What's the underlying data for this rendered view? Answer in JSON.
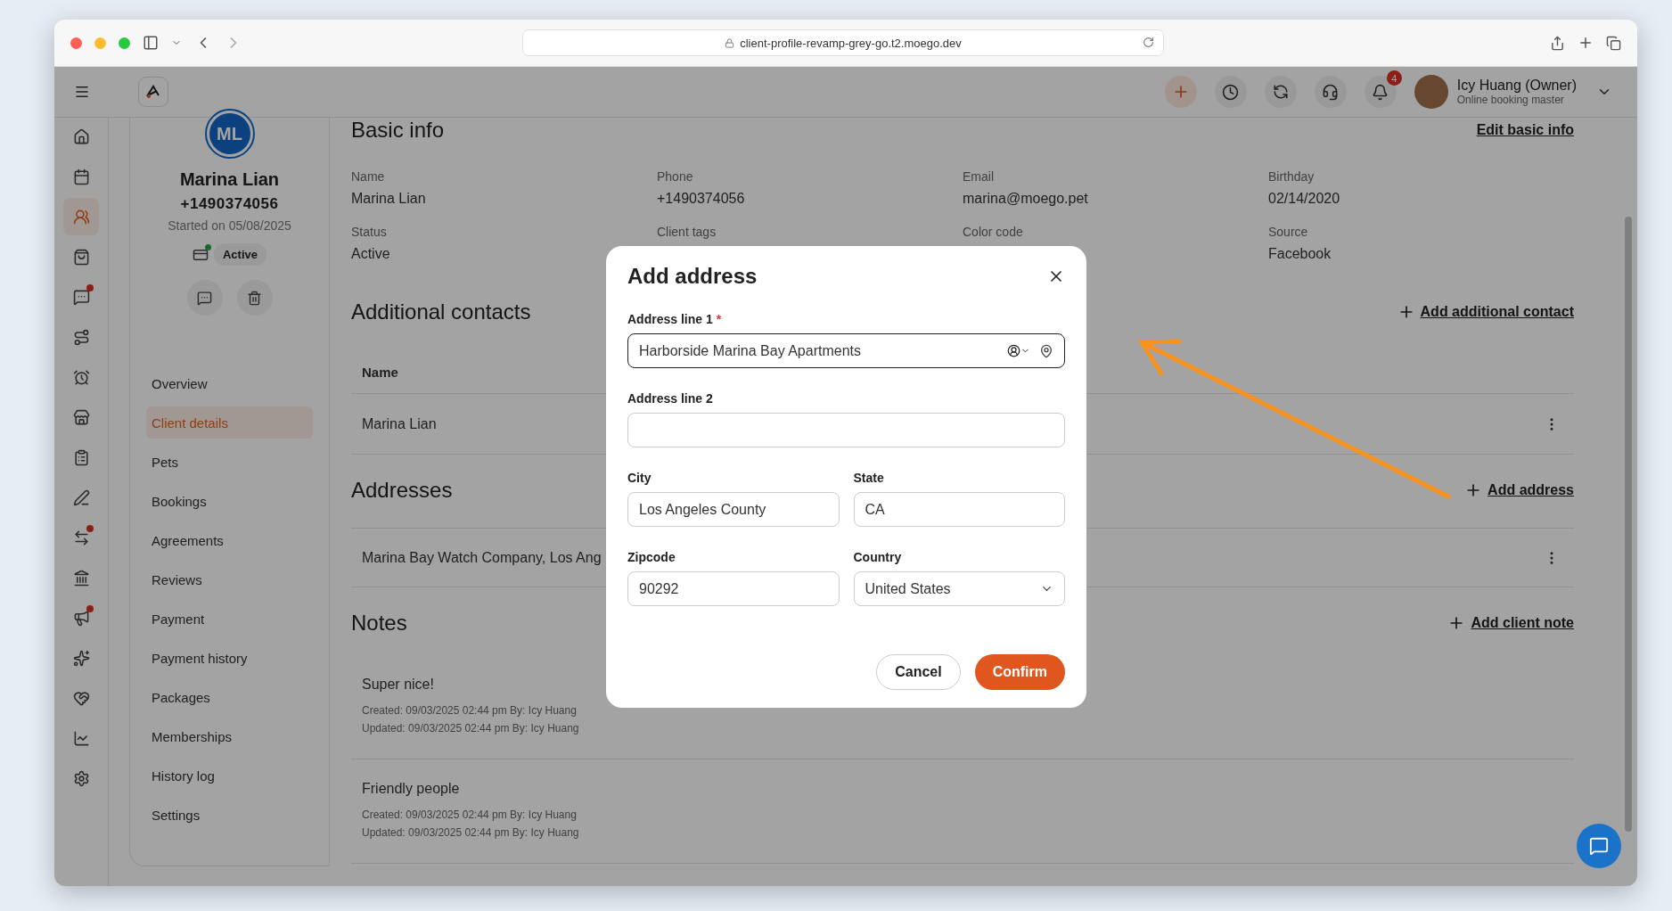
{
  "browser": {
    "url": "client-profile-revamp-grey-go.t2.moego.dev"
  },
  "app_bar": {
    "user_name": "Icy Huang (Owner)",
    "user_role": "Online booking master",
    "notification_count": "4"
  },
  "rail": {
    "items": [
      {
        "kind": "home",
        "selected": false,
        "dot": false
      },
      {
        "kind": "calendar",
        "selected": false,
        "dot": false
      },
      {
        "kind": "clients",
        "selected": true,
        "dot": false
      },
      {
        "kind": "bag",
        "selected": false,
        "dot": false
      },
      {
        "kind": "chat",
        "selected": false,
        "dot": true
      },
      {
        "kind": "route",
        "selected": false,
        "dot": false
      },
      {
        "kind": "alarm",
        "selected": false,
        "dot": false
      },
      {
        "kind": "store",
        "selected": false,
        "dot": false
      },
      {
        "kind": "clipboard",
        "selected": false,
        "dot": false
      },
      {
        "kind": "pen",
        "selected": false,
        "dot": false
      },
      {
        "kind": "swap",
        "selected": false,
        "dot": true
      },
      {
        "kind": "bank",
        "selected": false,
        "dot": false
      },
      {
        "kind": "megaphone",
        "selected": false,
        "dot": true
      },
      {
        "kind": "stars",
        "selected": false,
        "dot": false
      },
      {
        "kind": "heart",
        "selected": false,
        "dot": false
      },
      {
        "kind": "chart",
        "selected": false,
        "dot": false
      },
      {
        "kind": "settings",
        "selected": false,
        "dot": false
      }
    ]
  },
  "profile": {
    "initials": "ML",
    "name": "Marina Lian",
    "phone": "+1490374056",
    "started": "Started on 05/08/2025",
    "status": "Active",
    "nav": [
      {
        "label": "Overview",
        "selected": false
      },
      {
        "label": "Client details",
        "selected": true
      },
      {
        "label": "Pets",
        "selected": false
      },
      {
        "label": "Bookings",
        "selected": false
      },
      {
        "label": "Agreements",
        "selected": false
      },
      {
        "label": "Reviews",
        "selected": false
      },
      {
        "label": "Payment",
        "selected": false
      },
      {
        "label": "Payment history",
        "selected": false
      },
      {
        "label": "Packages",
        "selected": false
      },
      {
        "label": "Memberships",
        "selected": false
      },
      {
        "label": "History log",
        "selected": false
      },
      {
        "label": "Settings",
        "selected": false
      }
    ]
  },
  "basic_info": {
    "title": "Basic info",
    "action": "Edit basic info",
    "fields": [
      {
        "label": "Name",
        "value": "Marina Lian"
      },
      {
        "label": "Phone",
        "value": "+1490374056"
      },
      {
        "label": "Email",
        "value": "marina@moego.pet"
      },
      {
        "label": "Birthday",
        "value": "02/14/2020"
      },
      {
        "label": "Status",
        "value": "Active"
      },
      {
        "label": "Client tags"
      },
      {
        "label": "Color code"
      },
      {
        "label": "Source",
        "value": "Facebook"
      }
    ]
  },
  "contacts": {
    "title": "Additional contacts",
    "action": "Add additional contact",
    "columns": [
      "Name"
    ],
    "rows": [
      [
        "Marina Lian"
      ]
    ]
  },
  "addresses": {
    "title": "Addresses",
    "action": "Add address",
    "rows": [
      "Marina Bay Watch Company, Los Ang"
    ]
  },
  "notes": {
    "title": "Notes",
    "action": "Add client note",
    "items": [
      {
        "text": "Super nice!",
        "created": "Created: 09/03/2025 02:44 pm By: Icy Huang",
        "updated": "Updated: 09/03/2025 02:44 pm By: Icy Huang"
      },
      {
        "text": "Friendly people",
        "created": "Created: 09/03/2025 02:44 pm By: Icy Huang",
        "updated": "Updated: 09/03/2025 02:44 pm By: Icy Huang"
      }
    ]
  },
  "modal": {
    "title": "Add address",
    "fields": [
      {
        "label": "Address line 1",
        "required_mark": "*",
        "kind": "address",
        "value": "Harborside Marina Bay Apartments",
        "focused": true
      },
      {
        "label": "Address line 2",
        "kind": "text",
        "focused": false
      },
      {
        "label": "City",
        "kind": "text",
        "value": "Los Angeles County",
        "focused": false
      },
      {
        "label": "State",
        "kind": "text",
        "value": "CA",
        "focused": false
      },
      {
        "label": "Zipcode",
        "kind": "text",
        "value": "90292",
        "focused": false
      },
      {
        "label": "Country",
        "kind": "select",
        "value": "United States",
        "focused": false
      }
    ],
    "cancel": "Cancel",
    "confirm": "Confirm"
  }
}
